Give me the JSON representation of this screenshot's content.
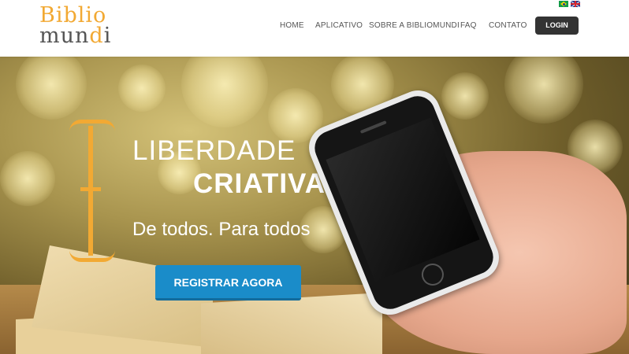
{
  "logo": {
    "line1": "Biblio",
    "line2_prefix": "mun",
    "line2_highlight": "d",
    "line2_suffix": "i"
  },
  "nav": {
    "items": [
      "HOME",
      "APLICATIVO",
      "SOBRE A BIBLIOMUNDI",
      "FAQ",
      "CONTATO"
    ],
    "login_label": "LOGIN"
  },
  "languages": [
    "brazil-flag-icon",
    "uk-flag-icon"
  ],
  "hero": {
    "line1": "LIBERDADE",
    "line2": "CRIATIVA",
    "subtitle": "De todos. Para todos",
    "cta_label": "REGISTRAR AGORA"
  },
  "colors": {
    "brand_orange": "#f2a933",
    "cta_blue": "#1a8cc9",
    "login_dark": "#333333"
  }
}
